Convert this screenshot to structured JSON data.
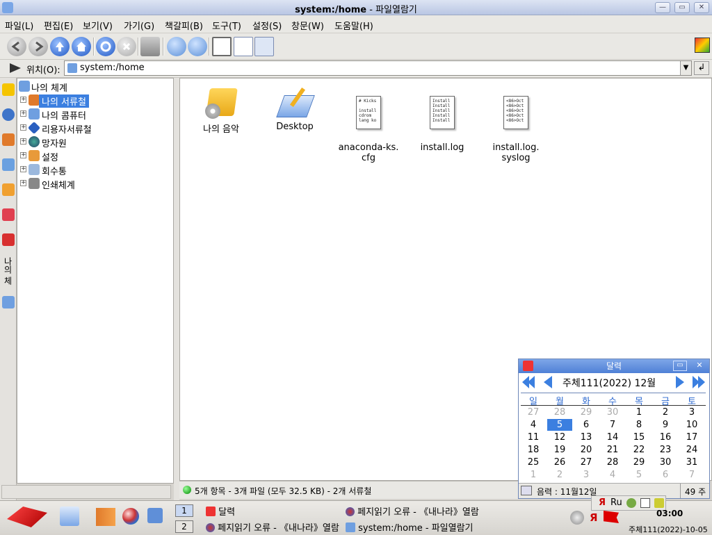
{
  "window": {
    "title_bold": "system:/home",
    "title_rest": " - 파일열람기",
    "btn_min": "—",
    "btn_max": "▭",
    "btn_close": "✕"
  },
  "menu": [
    "파일(L)",
    "편집(E)",
    "보기(V)",
    "가기(G)",
    "책갈피(B)",
    "도구(T)",
    "설정(S)",
    "창문(W)",
    "도움말(H)"
  ],
  "location": {
    "label": "위치(O):",
    "value": "system:/home",
    "go": "↲"
  },
  "left_strip_label": "나의 체계",
  "tree": {
    "root": "나의 체계",
    "items": [
      {
        "label": "나의 서류철",
        "selected": true
      },
      {
        "label": "나의 콤퓨터"
      },
      {
        "label": "리용자서류철"
      },
      {
        "label": "망자원"
      },
      {
        "label": "설정"
      },
      {
        "label": "회수통"
      },
      {
        "label": "인쇄체계"
      }
    ]
  },
  "files": [
    {
      "name": "나의 음악",
      "type": "folder-music"
    },
    {
      "name": "Desktop",
      "type": "folder-desktop"
    },
    {
      "name": "anaconda-ks.\ncfg",
      "type": "text",
      "preview": "# Kicks\n\ninstall\ncdrom\nlang ko"
    },
    {
      "name": "install.log",
      "type": "text",
      "preview": "Install\nInstall\nInstall\nInstall\nInstall"
    },
    {
      "name": "install.log.\nsyslog",
      "type": "text",
      "preview": "<86>Oct\n<86>Oct\n<86>Oct\n<86>Oct\n<86>Oct"
    }
  ],
  "status": "5개 항목 - 3개 파일 (모두 32.5 KB) - 2개 서류철",
  "calendar": {
    "title": "달력",
    "month_label": "주체111(2022) 12월",
    "weekdays": [
      "일",
      "월",
      "화",
      "수",
      "목",
      "금",
      "토"
    ],
    "weeks": [
      [
        {
          "d": "27",
          "o": 1
        },
        {
          "d": "28",
          "o": 1
        },
        {
          "d": "29",
          "o": 1
        },
        {
          "d": "30",
          "o": 1
        },
        {
          "d": "1"
        },
        {
          "d": "2"
        },
        {
          "d": "3"
        }
      ],
      [
        {
          "d": "4"
        },
        {
          "d": "5",
          "t": 1
        },
        {
          "d": "6"
        },
        {
          "d": "7"
        },
        {
          "d": "8"
        },
        {
          "d": "9"
        },
        {
          "d": "10"
        }
      ],
      [
        {
          "d": "11"
        },
        {
          "d": "12"
        },
        {
          "d": "13"
        },
        {
          "d": "14"
        },
        {
          "d": "15"
        },
        {
          "d": "16"
        },
        {
          "d": "17"
        }
      ],
      [
        {
          "d": "18"
        },
        {
          "d": "19"
        },
        {
          "d": "20"
        },
        {
          "d": "21"
        },
        {
          "d": "22"
        },
        {
          "d": "23"
        },
        {
          "d": "24"
        }
      ],
      [
        {
          "d": "25"
        },
        {
          "d": "26"
        },
        {
          "d": "27"
        },
        {
          "d": "28"
        },
        {
          "d": "29"
        },
        {
          "d": "30"
        },
        {
          "d": "31"
        }
      ],
      [
        {
          "d": "1",
          "o": 1
        },
        {
          "d": "2",
          "o": 1
        },
        {
          "d": "3",
          "o": 1
        },
        {
          "d": "4",
          "o": 1
        },
        {
          "d": "5",
          "o": 1
        },
        {
          "d": "6",
          "o": 1
        },
        {
          "d": "7",
          "o": 1
        }
      ]
    ],
    "lunar": "음력 : 11월12일",
    "week_no": "49 주"
  },
  "taskbar": {
    "desktops": [
      "1",
      "2"
    ],
    "tasks": [
      {
        "label": "달력"
      },
      {
        "label": "페지읽기 오류 - 《내나라》열람"
      },
      {
        "label": "페지읽기 오류 - 《내나라》열람"
      },
      {
        "label": "system:/home - 파일열람기"
      }
    ],
    "ime": "Ru",
    "clock_time": "03:00",
    "clock_date": "주체111(2022)-10-05"
  },
  "colors": {
    "selection": "#3b7fe0",
    "title_gradient": "#b9c6e3",
    "accent": "#2e6ad0"
  }
}
